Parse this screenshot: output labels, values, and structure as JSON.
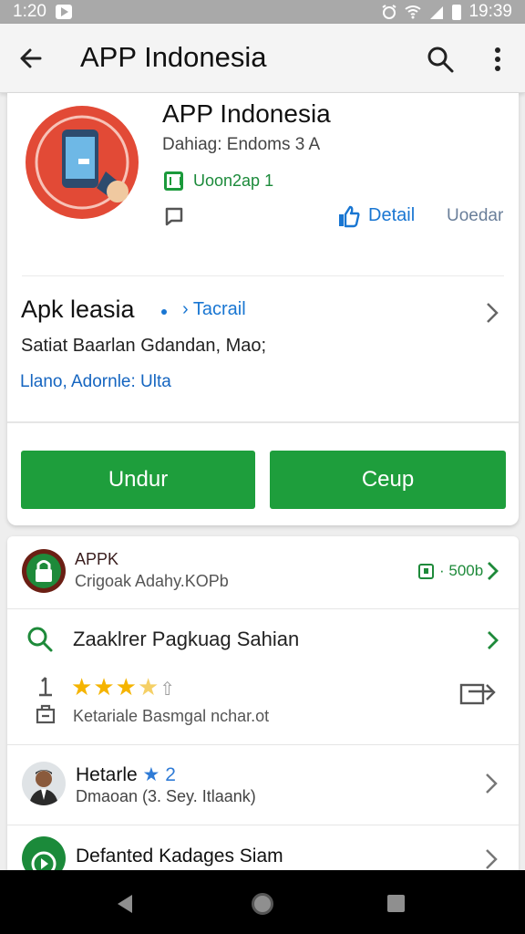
{
  "status_bar": {
    "time_left": "1:20",
    "time_right": "19:39"
  },
  "appbar": {
    "title": "APP Indonesia"
  },
  "app_header": {
    "title": "APP Indonesia",
    "developer": "Dahiag: Endoms 3 A",
    "age_rating": "Uoon2ap 1",
    "detail_label": "Detail",
    "update_label": "Uoedar"
  },
  "summary": {
    "title": "Apk leasia",
    "tag": "› Tacrail",
    "subtitle": "Satiat Baarlan Gdandan, Mao;",
    "link": "Llano, Adornle: Ulta"
  },
  "actions": {
    "primary": "Undur",
    "secondary": "Ceup"
  },
  "list": {
    "appk": {
      "title": "APPK",
      "subtitle": "Crigoak Adahy.KOPb",
      "size": "· 500b"
    },
    "review": {
      "title": "Zaaklrer Pagkuag Sahian",
      "rating_stars": 3.5,
      "text": "Ketariale Basmgal nchar.ot"
    },
    "author": {
      "name": "Hetarle",
      "star": "★",
      "count": "2",
      "subtitle": "Dmaoan (3. Sey. Itlaank)"
    },
    "related": {
      "title": "Defanted Kadages Siam"
    }
  },
  "colors": {
    "accent_green": "#1e9e3c",
    "link_blue": "#1976d2",
    "star_yellow": "#f5b400"
  },
  "icons": [
    "back-arrow-icon",
    "search-icon",
    "more-vert-icon",
    "shield-icon",
    "message-icon",
    "thumbs-up-icon",
    "chevron-right-icon",
    "download-icon",
    "lock-icon",
    "star-icon",
    "share-icon",
    "clipboard-icon",
    "play-icon",
    "nav-back-icon",
    "nav-home-icon",
    "nav-recent-icon"
  ]
}
